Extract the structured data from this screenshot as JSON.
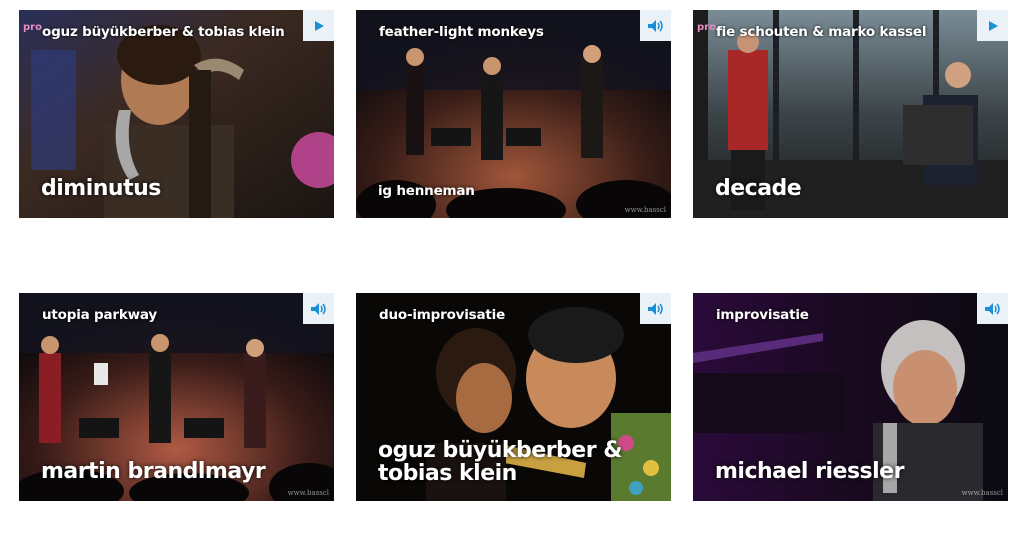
{
  "tiles": [
    {
      "top": "oguz büyükberber & tobias klein",
      "bottom": "diminutus",
      "icon": "play-icon",
      "pro": "pro",
      "watermark": ""
    },
    {
      "top": "feather-light monkeys",
      "bottom": "ig henneman",
      "icon": "speaker-icon",
      "pro": "",
      "watermark": "www.basscl"
    },
    {
      "top": "fie schouten & marko kassel",
      "bottom": "decade",
      "icon": "play-icon",
      "pro": "pro",
      "watermark": ""
    },
    {
      "top": "utopia parkway",
      "bottom": "martin brandlmayr",
      "icon": "speaker-icon",
      "pro": "",
      "watermark": "www.basscl"
    },
    {
      "top": "duo-improvisatie",
      "bottom": "oguz büyükberber & tobias klein",
      "icon": "speaker-icon",
      "pro": "",
      "watermark": ""
    },
    {
      "top": "improvisatie",
      "bottom": "michael riessler",
      "icon": "speaker-icon",
      "pro": "",
      "watermark": "www.basscl"
    }
  ],
  "colors": {
    "accent": "#1a8fd6",
    "button_bg": "#eaf2f7",
    "pro": "#e58cc2"
  }
}
